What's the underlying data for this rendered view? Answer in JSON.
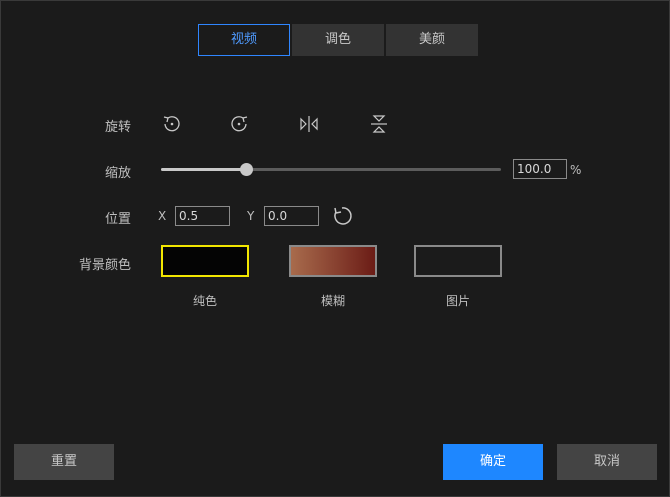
{
  "tabs": [
    {
      "label": "视频",
      "active": true
    },
    {
      "label": "调色",
      "active": false
    },
    {
      "label": "美颜",
      "active": false
    }
  ],
  "rotate": {
    "label": "旋转",
    "icons": [
      "rotate-left-icon",
      "rotate-right-icon",
      "flip-horizontal-icon",
      "flip-vertical-icon"
    ]
  },
  "scale": {
    "label": "缩放",
    "value_text": "100.0",
    "unit": "%",
    "level_fraction": 0.25
  },
  "position": {
    "label": "位置",
    "x_label": "X",
    "x_value": "0.5",
    "y_label": "Y",
    "y_value": "0.0",
    "reset_icon": "reset-icon"
  },
  "background": {
    "label": "背景颜色",
    "options": [
      {
        "caption": "纯色",
        "selected": true
      },
      {
        "caption": "模糊",
        "selected": false
      },
      {
        "caption": "图片",
        "selected": false
      }
    ]
  },
  "footer": {
    "reset_label": "重置",
    "confirm_label": "确定",
    "cancel_label": "取消"
  },
  "colors": {
    "accent": "#1e87ff",
    "selected_swatch_border": "#f2e600"
  }
}
